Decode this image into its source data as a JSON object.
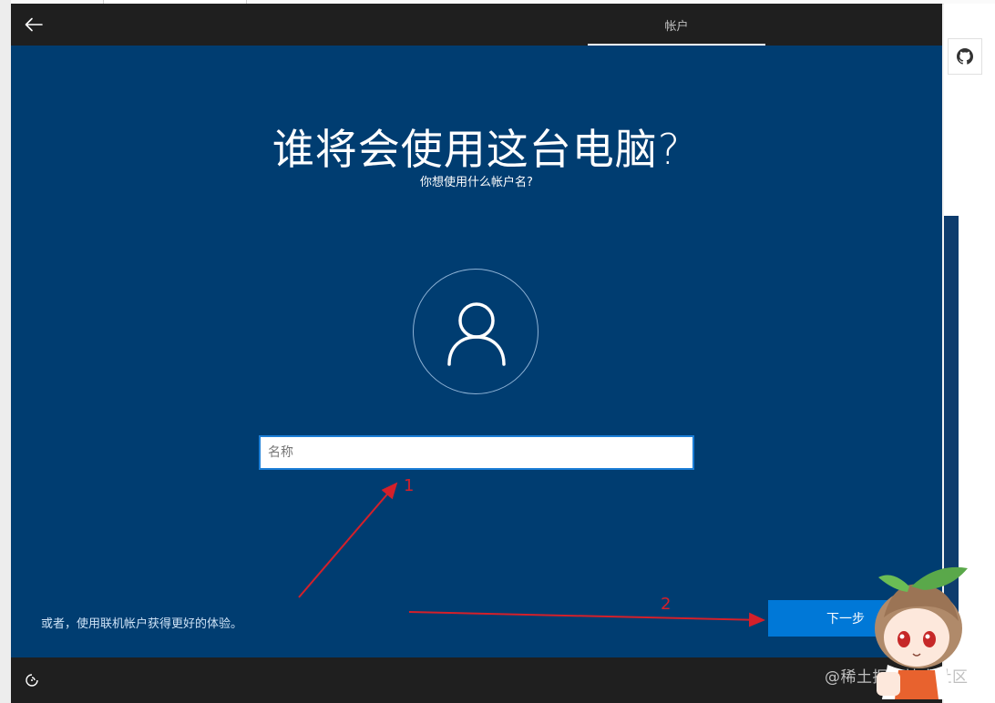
{
  "header": {
    "back_icon": "arrow-left-icon",
    "tab_label": "帐户"
  },
  "main": {
    "title": "谁将会使用这台电脑?",
    "subtitle": "你想使用什么帐户名?",
    "avatar_icon": "user-icon",
    "name_input": {
      "placeholder": "名称",
      "value": ""
    },
    "online_account_link": "或者，使用联机帐户获得更好的体验。",
    "next_button": "下一步"
  },
  "footer": {
    "ease_of_access_icon": "ease-of-access-icon"
  },
  "annotations": {
    "step1": "1",
    "step2": "2"
  },
  "watermark": "@稀土掘金技术社区",
  "colors": {
    "main_background": "#003d71",
    "header_background": "#1f1f1f",
    "next_button": "#0078d7",
    "annotation": "#d4202a"
  }
}
